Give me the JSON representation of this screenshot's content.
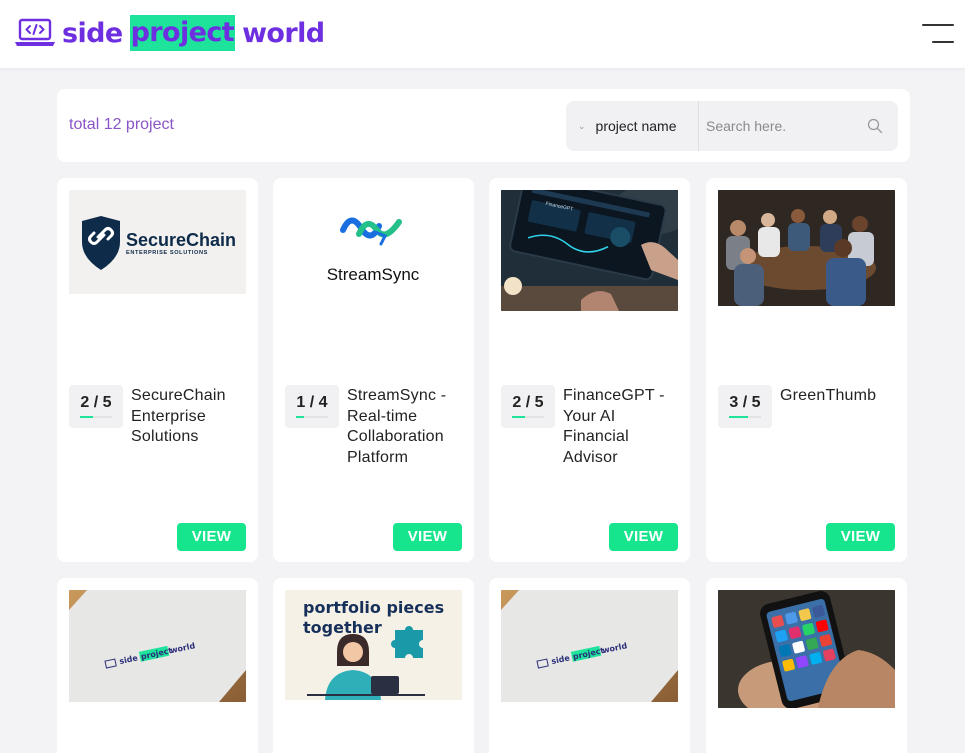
{
  "brand": {
    "prefix": "side",
    "highlight": "project",
    "suffix": "world",
    "logo_icon": "laptop-code-icon",
    "primary_color": "#6d2fe0",
    "highlight_color": "#1ee39a"
  },
  "header": {
    "menu_icon": "hamburger-menu-icon"
  },
  "toolbar": {
    "total_label": "total 12 project",
    "filter_selected": "project name",
    "search_placeholder": "Search here.",
    "search_value": ""
  },
  "colors": {
    "accent": "#17e58e",
    "total_text": "#8b55c7",
    "page_bg": "#f3f3f6"
  },
  "projects": [
    {
      "name": "SecureChain Enterprise Solutions",
      "score": "2 / 5",
      "score_fraction": 0.4,
      "action": "VIEW",
      "thumb_text": "SecureChain",
      "thumb_subtext": "ENTERPRISE SOLUTIONS"
    },
    {
      "name": "StreamSync - Real-time Collaboration Platform",
      "score": "1 / 4",
      "score_fraction": 0.25,
      "action": "VIEW",
      "thumb_text": "StreamSync"
    },
    {
      "name": "FinanceGPT - Your AI Financial Advisor",
      "score": "2 / 5",
      "score_fraction": 0.4,
      "action": "VIEW",
      "thumb_text": "FinanceGPT"
    },
    {
      "name": "GreenThumb",
      "score": "3 / 5",
      "score_fraction": 0.6,
      "action": "VIEW"
    },
    {
      "thumb_logo_prefix": "side",
      "thumb_logo_highlight": "project",
      "thumb_logo_suffix": "world"
    },
    {
      "thumb_text_line1": "portfolio pieces",
      "thumb_text_line2": "together"
    },
    {
      "thumb_logo_prefix": "side",
      "thumb_logo_highlight": "project",
      "thumb_logo_suffix": "world"
    },
    {
      "thumb_icon": "smartphone-apps-icon"
    }
  ]
}
